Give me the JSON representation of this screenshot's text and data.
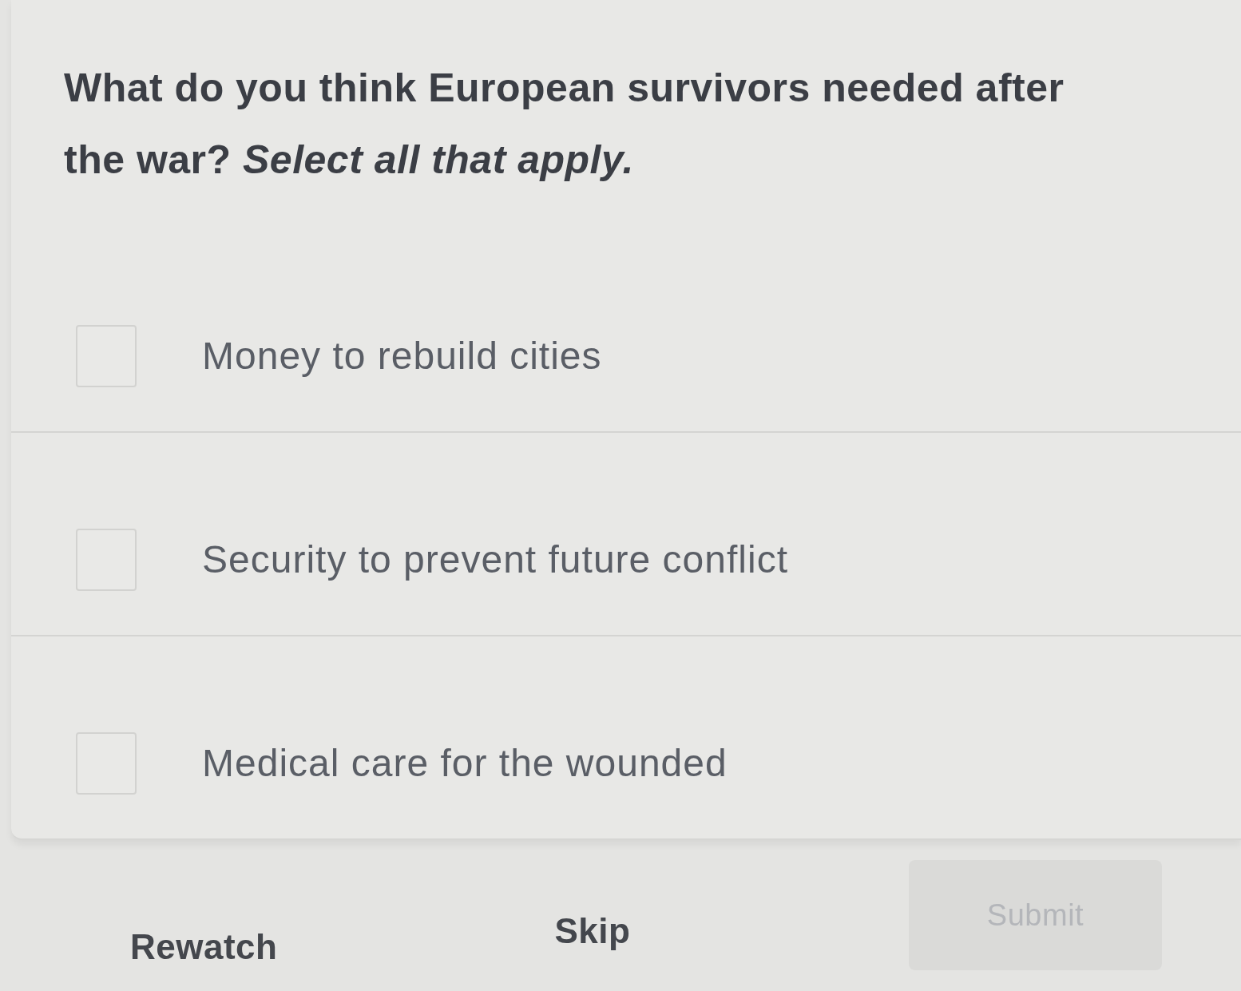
{
  "question": {
    "text": "What do you think European survivors needed after the war? *Select all that apply.*"
  },
  "options": [
    {
      "label": "Money to rebuild cities",
      "checked": false
    },
    {
      "label": "Security to prevent future conflict",
      "checked": false
    },
    {
      "label": "Medical care for the wounded",
      "checked": false
    }
  ],
  "buttons": [
    {
      "label": "Rewatch",
      "kind": "text",
      "disabled": false
    },
    {
      "label": "Skip",
      "kind": "text",
      "disabled": false
    },
    {
      "label": "Submit",
      "kind": "filled",
      "disabled": true
    }
  ]
}
